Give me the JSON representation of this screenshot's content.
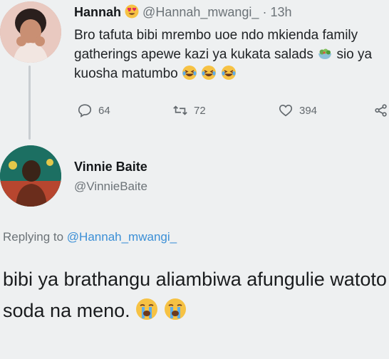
{
  "parent_tweet": {
    "display_name": "Hannah",
    "name_emoji": "heart-eyes-emoji",
    "handle": "@Hannah_mwangi_",
    "separator": "·",
    "time": "13h",
    "text_part1": "Bro tafuta bibi mrembo uoe ndo mkienda family gatherings apewe kazi ya kukata salads",
    "text_part2": " sio ya kuosha matumbo",
    "emojis": [
      "salad-emoji",
      "laughing-emoji",
      "laughing-emoji",
      "laughing-emoji"
    ],
    "replies": "64",
    "retweets": "72",
    "likes": "394"
  },
  "reply_tweet": {
    "display_name": "Vinnie Baite",
    "handle": "@VinnieBaite",
    "replying_label": "Replying to",
    "replying_to": "@Hannah_mwangi_",
    "text": "bibi ya brathangu aliambiwa afungulie watoto soda na meno.",
    "emojis": [
      "loudly-crying-emoji",
      "loudly-crying-emoji"
    ]
  },
  "colors": {
    "background": "#eef0f1",
    "secondary_text": "#6c7378",
    "mention_blue": "#3b8fd6",
    "emoji_yellow": "#f6c244"
  }
}
